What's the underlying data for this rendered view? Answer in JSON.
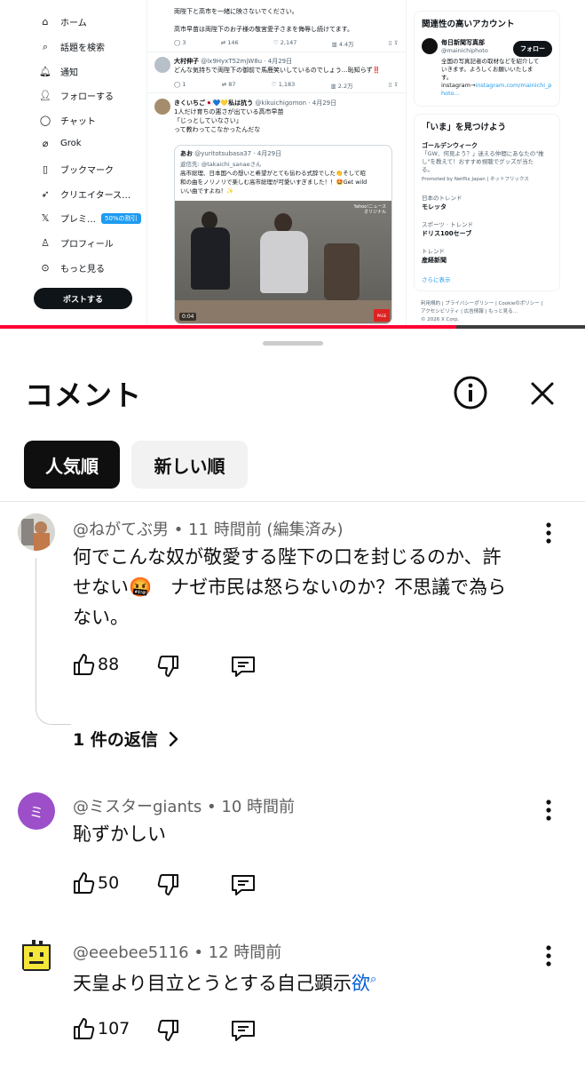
{
  "top_screenshot": {
    "sidebar": {
      "items": [
        {
          "label": "ホーム"
        },
        {
          "label": "話題を検索"
        },
        {
          "label": "通知"
        },
        {
          "label": "フォローする"
        },
        {
          "label": "チャット"
        },
        {
          "label": "Grok"
        },
        {
          "label": "ブックマーク"
        },
        {
          "label": "クリエイタース…"
        },
        {
          "label": "プレミ…",
          "badge": "50%の割引"
        },
        {
          "label": "プロフィール"
        },
        {
          "label": "もっと見る"
        }
      ],
      "post_button": "ポストする"
    },
    "feed": {
      "post1_line1": "両陛下と高市を一緒に映さないでください。",
      "post1_line2": "高市早苗は両陛下のお子様の敬宮愛子さまを侮辱し続けてます。",
      "post1_stats": [
        "3",
        "146",
        "2,147",
        "4.4万"
      ],
      "post2_name": "大村伸子",
      "post2_handle": "@lx9HyxT52mjW8u · 4月29日",
      "post2_text": "どんな気持ちで両陛下の御前で馬鹿笑いしているのでしょう…恥知らず‼️",
      "post2_stats": [
        "1",
        "87",
        "1,183",
        "2.2万"
      ],
      "post3_name": "きくいちご🇯🇵💙💛私は抗う",
      "post3_handle": "@kikuichigomon · 4月29日",
      "post3_line1": "1人だけ育ちの悪さが出ている高市早苗",
      "post3_line2": "「じっとしていなさい」",
      "post3_line3": "って教わってこなかったんだな",
      "quote_name": "あお",
      "quote_handle": "@yuritotsubasa37 · 4月29日",
      "quote_line1": "返信先: @takaichi_sanaeさん",
      "quote_line2": "高市総理、日本国への想いと希望がとても伝わる式辞でした👏そして昭",
      "quote_line3": "和の曲をノリノリで楽しむ高市総理が可愛いすぎました！！🤩Get wild",
      "quote_line4": "いい曲ですよね！✨",
      "video_time": "0:04",
      "video_logo_top": "Yahoo!ニュース",
      "video_logo_bottom": "オリジナル",
      "video_corner": "PAGE"
    },
    "right": {
      "related_title": "関連性の高いアカウント",
      "account_name": "毎日新聞写真部",
      "account_handle": "@mainichiphoto",
      "follow_button": "フォロー",
      "account_bio1": "全国の写真記者の取材などを紹介して",
      "account_bio2": "いきます。よろしくお願いいたしま",
      "account_bio3": "す。",
      "account_bio4": "instagram→",
      "account_bio4_link": "instagram.com/mainichi_p",
      "account_bio5_link": "hoto…",
      "trends_title": "「いま」を見つけよう",
      "trend1_title": "ゴールデンウィーク",
      "trend1_desc1": "「GW、何見よう？」迷える仲間にあなたの\"推",
      "trend1_desc2": "し\"を教えて！おすすめ視聴でグッズが当た",
      "trend1_desc3": "る。",
      "trend1_promo": "Promoted by Netflix Japan | ネットフリックス",
      "trend2_cat": "日本のトレンド",
      "trend2_name": "モレッタ",
      "trend3_cat": "スポーツ · トレンド",
      "trend3_name": "ドリス100セーブ",
      "trend4_cat": "トレンド",
      "trend4_name": "産経新聞",
      "show_more": "さらに表示",
      "footer1": "利用規約 | プライバシーポリシー | Cookieのポリシー |",
      "footer2": "アクセシビリティ | 広告情報 | もっと見る…",
      "footer3": "© 2026 X Corp."
    },
    "progress_fraction": 0.78
  },
  "sheet": {
    "title": "コメント",
    "sort_chips": [
      {
        "label": "人気順",
        "selected": true
      },
      {
        "label": "新しい順",
        "selected": false
      }
    ]
  },
  "comments": [
    {
      "author": "@ねがてぶ男",
      "time": "• 11 時間前 (編集済み)",
      "text_line1": "何でこんな奴が敬愛する陛下の口を封じるのか、許",
      "text_line2": "せない🤬　ナゼ市民は怒らないのか？不思議で為ら",
      "text_line3": "ない。",
      "likes": "88",
      "replies": "1 件の返信"
    },
    {
      "author": "@ミスターgiants",
      "time": "• 10 時間前",
      "avatar_letter": "ミ",
      "text_line1": "恥ずかしい",
      "likes": "50"
    },
    {
      "author": "@eeebee5116",
      "time": "• 12 時間前",
      "text_before": "天皇より目立とうとする自己顕示",
      "text_link": "欲",
      "likes": "107"
    }
  ],
  "colors": {
    "progress": "#ff0033",
    "avatar_purple": "#9c4fc9",
    "link_blue": "#065fd4",
    "x_blue": "#1d9bf0"
  }
}
